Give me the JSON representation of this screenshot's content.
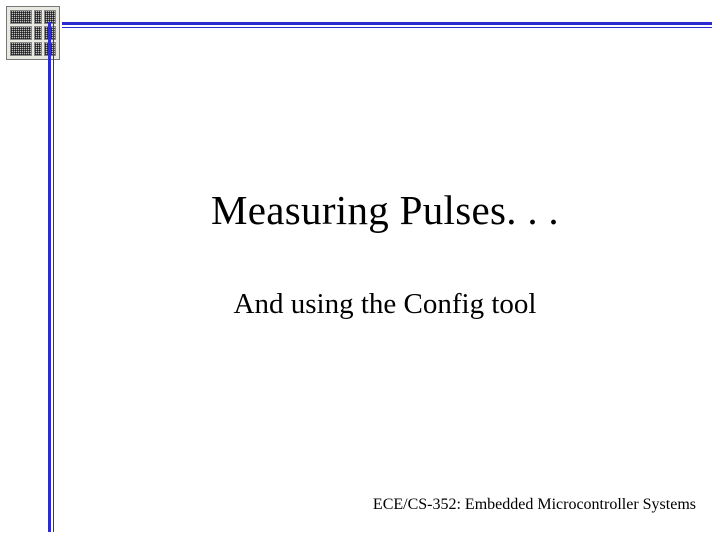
{
  "slide": {
    "title": "Measuring Pulses. . .",
    "subtitle": "And using the Config tool",
    "footer": "ECE/CS-352: Embedded Microcontroller Systems"
  }
}
